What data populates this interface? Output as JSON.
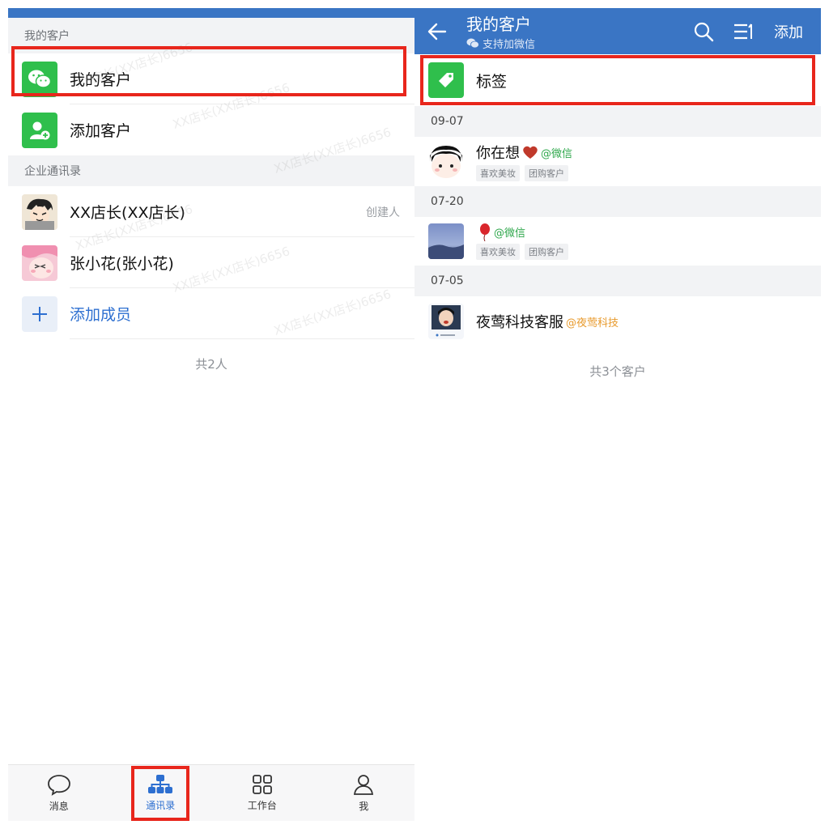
{
  "left": {
    "section_my_customers": "我的客户",
    "my_customers_item": "我的客户",
    "add_customer_item": "添加客户",
    "section_directory": "企业通讯录",
    "members": [
      {
        "name": "XX店长(XX店长)",
        "role": "创建人"
      },
      {
        "name": "张小花(张小花)",
        "role": ""
      }
    ],
    "add_member": "添加成员",
    "total": "共2人",
    "watermark": "XX店长(XX店长)6656",
    "tabs": [
      {
        "label": "消息",
        "icon": "chat-bubble-icon",
        "active": false
      },
      {
        "label": "通讯录",
        "icon": "org-chart-icon",
        "active": true
      },
      {
        "label": "工作台",
        "icon": "grid-apps-icon",
        "active": false
      },
      {
        "label": "我",
        "icon": "person-icon",
        "active": false
      }
    ]
  },
  "right": {
    "title": "我的客户",
    "subtitle": "支持加微信",
    "add_label": "添加",
    "tag_item": "标签",
    "groups": [
      {
        "date": "09-07",
        "customers": [
          {
            "name": "你在想",
            "source": "@微信",
            "source_color": "green",
            "tags": [
              "喜欢美妆",
              "团购客户"
            ]
          }
        ]
      },
      {
        "date": "07-20",
        "customers": [
          {
            "name": "",
            "source": "@微信",
            "source_color": "green",
            "tags": [
              "喜欢美妆",
              "团购客户"
            ]
          }
        ]
      },
      {
        "date": "07-05",
        "customers": [
          {
            "name": "夜莺科技客服",
            "source": "@夜莺科技",
            "source_color": "orange",
            "tags": []
          }
        ]
      }
    ],
    "total": "共3个客户"
  },
  "colors": {
    "brand_blue": "#3a75c4",
    "wechat_green": "#2fbf4c",
    "highlight_red": "#e8261c",
    "link_blue": "#2d6fd0"
  }
}
